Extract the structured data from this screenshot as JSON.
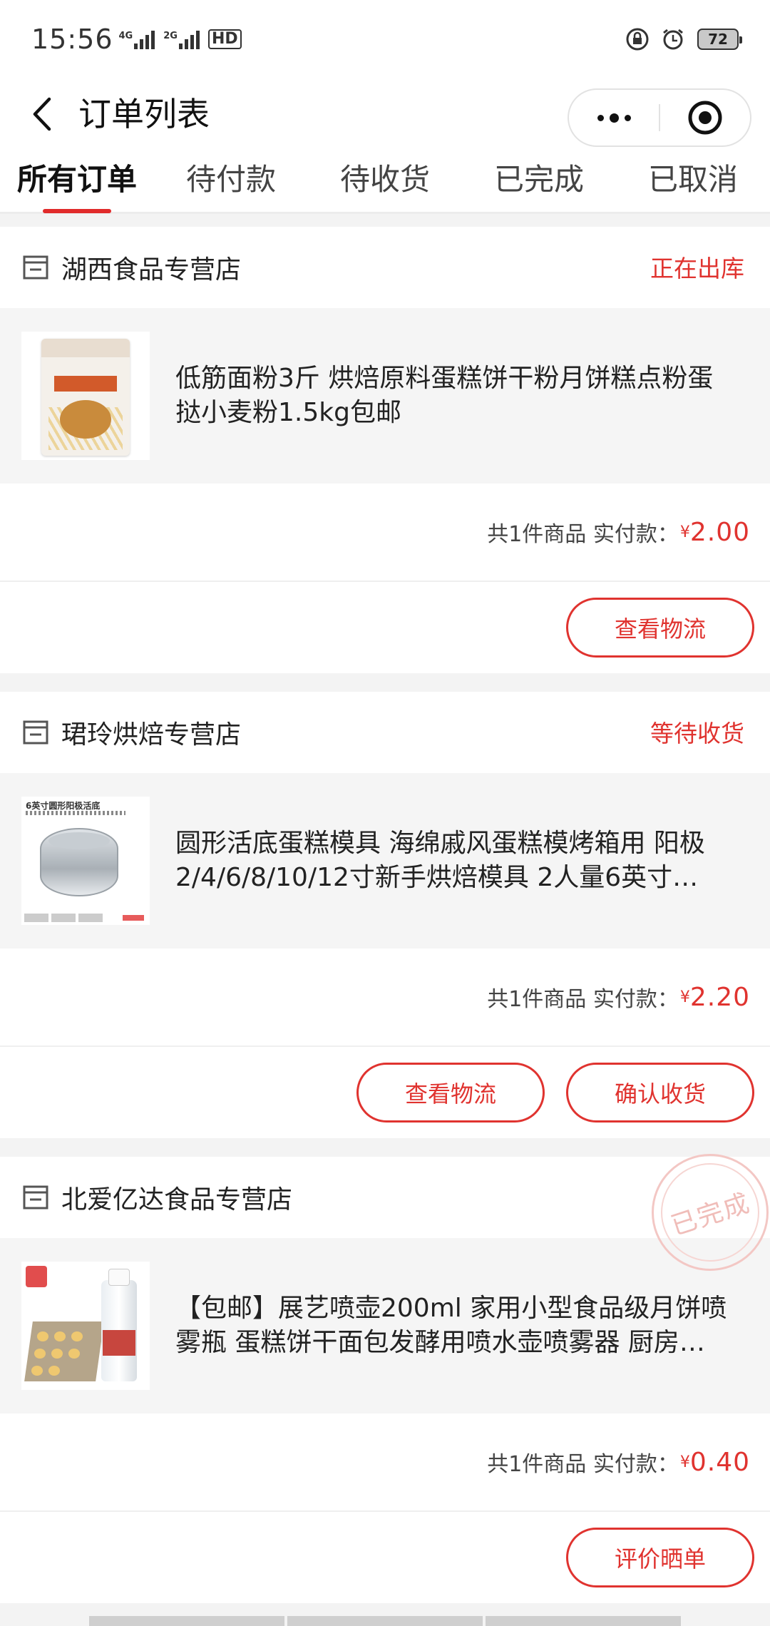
{
  "status_bar": {
    "time": "15:56",
    "network_1": "4G",
    "network_2": "2G",
    "hd_label": "HD",
    "battery": "72"
  },
  "nav": {
    "title": "订单列表",
    "back_icon": "chevron-left-icon",
    "more_icon": "more-dots-icon",
    "close_icon": "target-circle-icon"
  },
  "tabs": [
    {
      "label": "所有订单",
      "active": true
    },
    {
      "label": "待付款",
      "active": false
    },
    {
      "label": "待收货",
      "active": false
    },
    {
      "label": "已完成",
      "active": false
    },
    {
      "label": "已取消",
      "active": false
    }
  ],
  "orders": [
    {
      "shop": "湖西食品专营店",
      "status": "正在出库",
      "title": "低筋面粉3斤 烘焙原料蛋糕饼干粉月饼糕点粉蛋挞小麦粉1.5kg包邮",
      "summary": "共1件商品 实付款：",
      "currency": "¥",
      "amount": "2.00",
      "buttons": [
        "查看物流"
      ]
    },
    {
      "shop": "珺玲烘焙专营店",
      "status": "等待收货",
      "title": "圆形活底蛋糕模具 海绵戚风蛋糕模烤箱用 阳极2/4/6/8/10/12寸新手烘焙模具 2人量6英寸…",
      "summary": "共1件商品 实付款：",
      "currency": "¥",
      "amount": "2.20",
      "thumb_caption": "6英寸圆形阳极活底",
      "buttons": [
        "查看物流",
        "确认收货"
      ]
    },
    {
      "shop": "北爱亿达食品专营店",
      "status": "",
      "stamp": "已完成",
      "title": "【包邮】展艺喷壶200ml 家用小型食品级月饼喷雾瓶 蛋糕饼干面包发酵用喷水壶喷雾器 厨房…",
      "summary": "共1件商品 实付款：",
      "currency": "¥",
      "amount": "0.40",
      "buttons": [
        "评价晒单"
      ]
    }
  ],
  "colors": {
    "accent": "#e0332f",
    "page_bg": "#f3f3f3",
    "goods_bg": "#f5f5f5"
  }
}
